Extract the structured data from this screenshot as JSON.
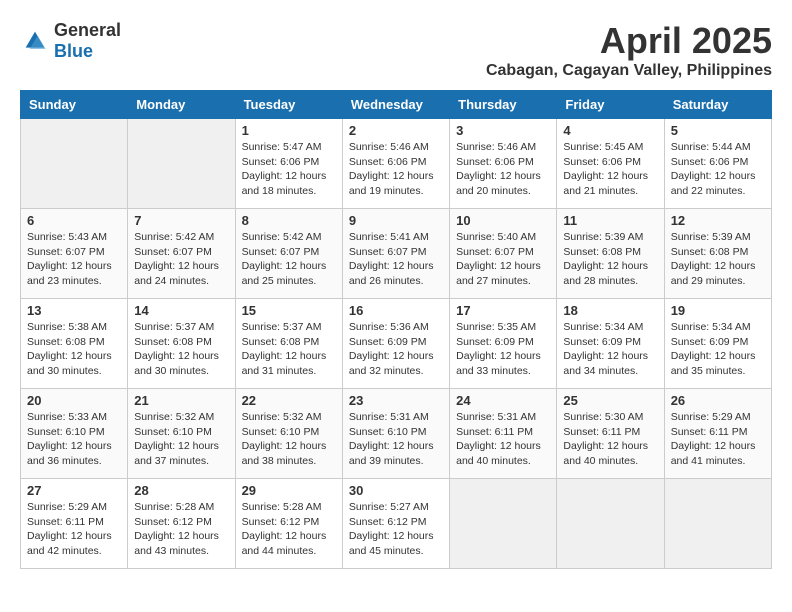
{
  "header": {
    "logo_general": "General",
    "logo_blue": "Blue",
    "month_title": "April 2025",
    "location": "Cabagan, Cagayan Valley, Philippines"
  },
  "calendar": {
    "days_of_week": [
      "Sunday",
      "Monday",
      "Tuesday",
      "Wednesday",
      "Thursday",
      "Friday",
      "Saturday"
    ],
    "weeks": [
      [
        {
          "day": "",
          "sunrise": "",
          "sunset": "",
          "daylight": ""
        },
        {
          "day": "",
          "sunrise": "",
          "sunset": "",
          "daylight": ""
        },
        {
          "day": "1",
          "sunrise": "Sunrise: 5:47 AM",
          "sunset": "Sunset: 6:06 PM",
          "daylight": "Daylight: 12 hours and 18 minutes."
        },
        {
          "day": "2",
          "sunrise": "Sunrise: 5:46 AM",
          "sunset": "Sunset: 6:06 PM",
          "daylight": "Daylight: 12 hours and 19 minutes."
        },
        {
          "day": "3",
          "sunrise": "Sunrise: 5:46 AM",
          "sunset": "Sunset: 6:06 PM",
          "daylight": "Daylight: 12 hours and 20 minutes."
        },
        {
          "day": "4",
          "sunrise": "Sunrise: 5:45 AM",
          "sunset": "Sunset: 6:06 PM",
          "daylight": "Daylight: 12 hours and 21 minutes."
        },
        {
          "day": "5",
          "sunrise": "Sunrise: 5:44 AM",
          "sunset": "Sunset: 6:06 PM",
          "daylight": "Daylight: 12 hours and 22 minutes."
        }
      ],
      [
        {
          "day": "6",
          "sunrise": "Sunrise: 5:43 AM",
          "sunset": "Sunset: 6:07 PM",
          "daylight": "Daylight: 12 hours and 23 minutes."
        },
        {
          "day": "7",
          "sunrise": "Sunrise: 5:42 AM",
          "sunset": "Sunset: 6:07 PM",
          "daylight": "Daylight: 12 hours and 24 minutes."
        },
        {
          "day": "8",
          "sunrise": "Sunrise: 5:42 AM",
          "sunset": "Sunset: 6:07 PM",
          "daylight": "Daylight: 12 hours and 25 minutes."
        },
        {
          "day": "9",
          "sunrise": "Sunrise: 5:41 AM",
          "sunset": "Sunset: 6:07 PM",
          "daylight": "Daylight: 12 hours and 26 minutes."
        },
        {
          "day": "10",
          "sunrise": "Sunrise: 5:40 AM",
          "sunset": "Sunset: 6:07 PM",
          "daylight": "Daylight: 12 hours and 27 minutes."
        },
        {
          "day": "11",
          "sunrise": "Sunrise: 5:39 AM",
          "sunset": "Sunset: 6:08 PM",
          "daylight": "Daylight: 12 hours and 28 minutes."
        },
        {
          "day": "12",
          "sunrise": "Sunrise: 5:39 AM",
          "sunset": "Sunset: 6:08 PM",
          "daylight": "Daylight: 12 hours and 29 minutes."
        }
      ],
      [
        {
          "day": "13",
          "sunrise": "Sunrise: 5:38 AM",
          "sunset": "Sunset: 6:08 PM",
          "daylight": "Daylight: 12 hours and 30 minutes."
        },
        {
          "day": "14",
          "sunrise": "Sunrise: 5:37 AM",
          "sunset": "Sunset: 6:08 PM",
          "daylight": "Daylight: 12 hours and 30 minutes."
        },
        {
          "day": "15",
          "sunrise": "Sunrise: 5:37 AM",
          "sunset": "Sunset: 6:08 PM",
          "daylight": "Daylight: 12 hours and 31 minutes."
        },
        {
          "day": "16",
          "sunrise": "Sunrise: 5:36 AM",
          "sunset": "Sunset: 6:09 PM",
          "daylight": "Daylight: 12 hours and 32 minutes."
        },
        {
          "day": "17",
          "sunrise": "Sunrise: 5:35 AM",
          "sunset": "Sunset: 6:09 PM",
          "daylight": "Daylight: 12 hours and 33 minutes."
        },
        {
          "day": "18",
          "sunrise": "Sunrise: 5:34 AM",
          "sunset": "Sunset: 6:09 PM",
          "daylight": "Daylight: 12 hours and 34 minutes."
        },
        {
          "day": "19",
          "sunrise": "Sunrise: 5:34 AM",
          "sunset": "Sunset: 6:09 PM",
          "daylight": "Daylight: 12 hours and 35 minutes."
        }
      ],
      [
        {
          "day": "20",
          "sunrise": "Sunrise: 5:33 AM",
          "sunset": "Sunset: 6:10 PM",
          "daylight": "Daylight: 12 hours and 36 minutes."
        },
        {
          "day": "21",
          "sunrise": "Sunrise: 5:32 AM",
          "sunset": "Sunset: 6:10 PM",
          "daylight": "Daylight: 12 hours and 37 minutes."
        },
        {
          "day": "22",
          "sunrise": "Sunrise: 5:32 AM",
          "sunset": "Sunset: 6:10 PM",
          "daylight": "Daylight: 12 hours and 38 minutes."
        },
        {
          "day": "23",
          "sunrise": "Sunrise: 5:31 AM",
          "sunset": "Sunset: 6:10 PM",
          "daylight": "Daylight: 12 hours and 39 minutes."
        },
        {
          "day": "24",
          "sunrise": "Sunrise: 5:31 AM",
          "sunset": "Sunset: 6:11 PM",
          "daylight": "Daylight: 12 hours and 40 minutes."
        },
        {
          "day": "25",
          "sunrise": "Sunrise: 5:30 AM",
          "sunset": "Sunset: 6:11 PM",
          "daylight": "Daylight: 12 hours and 40 minutes."
        },
        {
          "day": "26",
          "sunrise": "Sunrise: 5:29 AM",
          "sunset": "Sunset: 6:11 PM",
          "daylight": "Daylight: 12 hours and 41 minutes."
        }
      ],
      [
        {
          "day": "27",
          "sunrise": "Sunrise: 5:29 AM",
          "sunset": "Sunset: 6:11 PM",
          "daylight": "Daylight: 12 hours and 42 minutes."
        },
        {
          "day": "28",
          "sunrise": "Sunrise: 5:28 AM",
          "sunset": "Sunset: 6:12 PM",
          "daylight": "Daylight: 12 hours and 43 minutes."
        },
        {
          "day": "29",
          "sunrise": "Sunrise: 5:28 AM",
          "sunset": "Sunset: 6:12 PM",
          "daylight": "Daylight: 12 hours and 44 minutes."
        },
        {
          "day": "30",
          "sunrise": "Sunrise: 5:27 AM",
          "sunset": "Sunset: 6:12 PM",
          "daylight": "Daylight: 12 hours and 45 minutes."
        },
        {
          "day": "",
          "sunrise": "",
          "sunset": "",
          "daylight": ""
        },
        {
          "day": "",
          "sunrise": "",
          "sunset": "",
          "daylight": ""
        },
        {
          "day": "",
          "sunrise": "",
          "sunset": "",
          "daylight": ""
        }
      ]
    ]
  }
}
